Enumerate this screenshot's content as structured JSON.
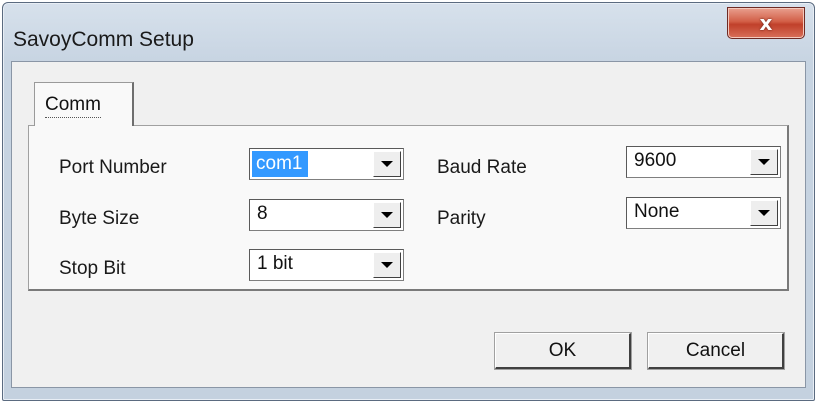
{
  "window": {
    "title": "SavoyComm Setup",
    "close_glyph": "x"
  },
  "tabs": [
    {
      "label": "Comm"
    }
  ],
  "fields": {
    "port_number": {
      "label": "Port Number",
      "value": "com1"
    },
    "byte_size": {
      "label": "Byte Size",
      "value": "8"
    },
    "stop_bit": {
      "label": "Stop Bit",
      "value": "1 bit"
    },
    "baud_rate": {
      "label": "Baud Rate",
      "value": "9600"
    },
    "parity": {
      "label": "Parity",
      "value": "None"
    }
  },
  "buttons": {
    "ok": "OK",
    "cancel": "Cancel"
  },
  "icons": {
    "close": "close-icon",
    "dropdown": "chevron-down-icon"
  },
  "colors": {
    "close_button": "#c0402a",
    "selection": "#3399ff"
  }
}
